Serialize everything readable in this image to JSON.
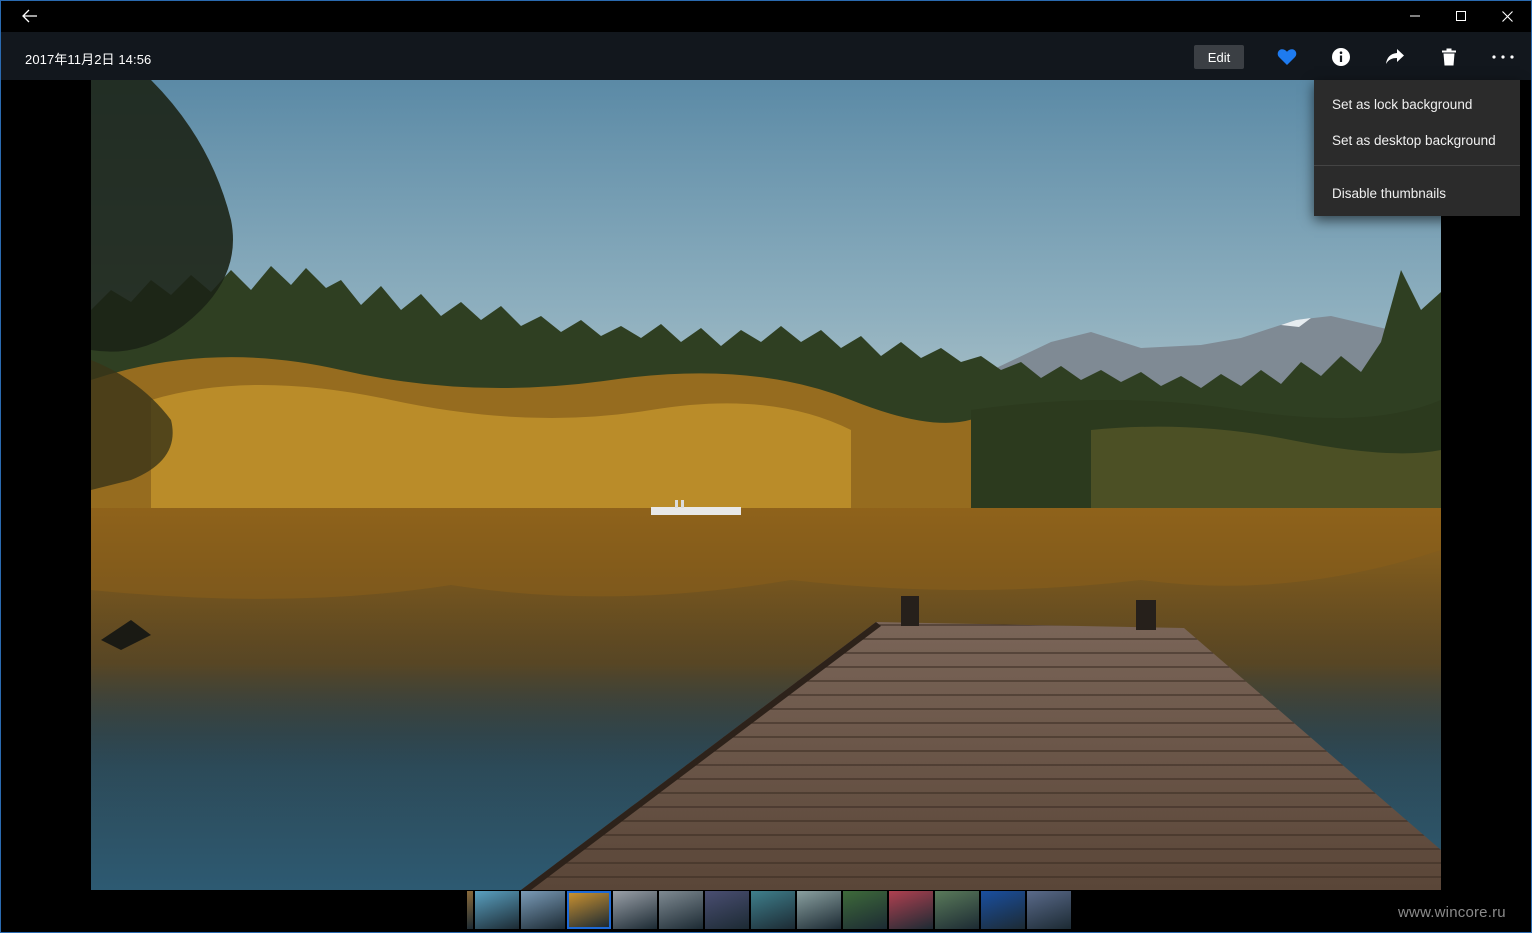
{
  "window": {
    "back_icon": "back-arrow-icon",
    "minimize_icon": "minimize-icon",
    "maximize_icon": "maximize-icon",
    "close_icon": "close-icon"
  },
  "header": {
    "date": "2017年11月2日 14:56",
    "edit_label": "Edit",
    "icons": [
      "heart-icon",
      "info-icon",
      "share-icon",
      "delete-icon",
      "more-icon"
    ],
    "heart_color": "#1e7bf0"
  },
  "menu": {
    "items": [
      "Set as lock background",
      "Set as desktop background",
      "Disable thumbnails"
    ]
  },
  "filmstrip": {
    "selected_index": 3,
    "thumb_colors": [
      "#8a6a3a",
      "#5aa0c0",
      "#7a9bb8",
      "#c89030",
      "#9aa0a8",
      "#7f8a92",
      "#4a4e72",
      "#3f7f8c",
      "#8aa0a0",
      "#3e6a3a",
      "#b04050",
      "#5a7a5a",
      "#1a4fa0",
      "#5a6a8a"
    ]
  },
  "watermark": "www.wincore.ru"
}
